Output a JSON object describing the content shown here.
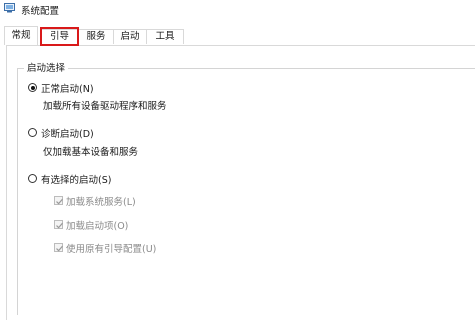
{
  "window": {
    "title": "系统配置",
    "icon": "system-config-icon"
  },
  "tabs": [
    {
      "label": "常规",
      "active": true
    },
    {
      "label": "引导",
      "highlighted": true
    },
    {
      "label": "服务"
    },
    {
      "label": "启动"
    },
    {
      "label": "工具"
    }
  ],
  "startup_selection": {
    "group_label": "启动选择",
    "options": [
      {
        "label": "正常启动(N)",
        "description": "加载所有设备驱动程序和服务",
        "selected": true
      },
      {
        "label": "诊断启动(D)",
        "description": "仅加载基本设备和服务",
        "selected": false
      },
      {
        "label": "有选择的启动(S)",
        "selected": false
      }
    ],
    "selective_items": [
      {
        "label": "加载系统服务(L)",
        "checked": true,
        "enabled": false
      },
      {
        "label": "加载启动项(O)",
        "checked": true,
        "enabled": false
      },
      {
        "label": "使用原有引导配置(U)",
        "checked": true,
        "enabled": false
      }
    ]
  },
  "colors": {
    "highlight_border": "#d9191a",
    "disabled_text": "#8a8a8a"
  }
}
